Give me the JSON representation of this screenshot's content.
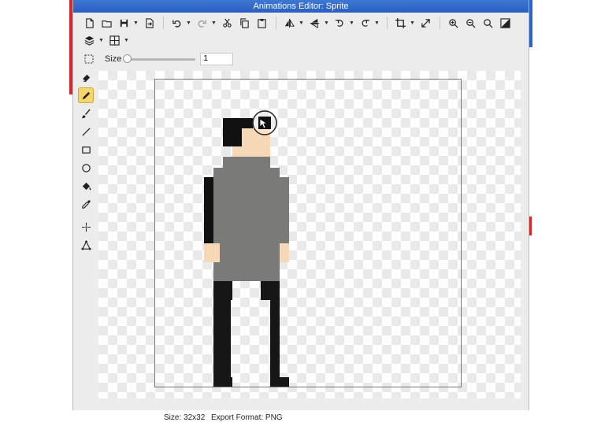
{
  "window": {
    "title": "Animations Editor: Sprite"
  },
  "toolbar": {
    "row1": [
      {
        "name": "new-file-icon",
        "caret": false
      },
      {
        "name": "open-folder-icon",
        "caret": false
      },
      {
        "name": "save-icon",
        "caret": true
      },
      {
        "name": "export-icon",
        "caret": false
      },
      {
        "sep": true
      },
      {
        "name": "undo-icon",
        "caret": true
      },
      {
        "name": "redo-icon",
        "caret": true
      },
      {
        "name": "cut-icon",
        "caret": false
      },
      {
        "name": "copy-icon",
        "caret": false
      },
      {
        "name": "paste-icon",
        "caret": false
      },
      {
        "sep": true
      },
      {
        "name": "flip-horizontal-icon",
        "caret": true
      },
      {
        "name": "flip-vertical-icon",
        "caret": true
      },
      {
        "name": "rotate-left-icon",
        "caret": true
      },
      {
        "name": "rotate-right-icon",
        "caret": true
      },
      {
        "sep": true
      },
      {
        "name": "crop-icon",
        "caret": true
      },
      {
        "name": "resize-icon",
        "caret": false
      },
      {
        "sep": true
      },
      {
        "name": "zoom-in-icon",
        "caret": false
      },
      {
        "name": "zoom-out-icon",
        "caret": false
      },
      {
        "name": "zoom-fit-icon",
        "caret": false
      },
      {
        "name": "invert-icon",
        "caret": false
      }
    ],
    "row2": [
      {
        "name": "layers-icon",
        "caret": true
      },
      {
        "name": "grid-icon",
        "caret": true
      }
    ]
  },
  "brush": {
    "size_label": "Size",
    "size_value": "1",
    "size_fraction": 0.0
  },
  "tools": [
    {
      "name": "eraser-icon",
      "active": false
    },
    {
      "name": "pencil-icon",
      "active": true
    },
    {
      "name": "brush-icon",
      "active": false
    },
    {
      "name": "line-icon",
      "active": false
    },
    {
      "name": "rectangle-icon",
      "active": false
    },
    {
      "name": "ellipse-icon",
      "active": false
    },
    {
      "name": "fill-bucket-icon",
      "active": false
    },
    {
      "name": "eyedropper-icon",
      "active": false
    },
    {
      "gap": true
    },
    {
      "name": "magic-wand-icon",
      "active": false
    },
    {
      "name": "transform-icon",
      "active": false
    }
  ],
  "status": {
    "size_text": "Size: 32x32",
    "format_text": "Export Format: PNG"
  },
  "colors": {
    "hair": "#111111",
    "skin": "#f7d8b6",
    "shirt": "#7a7a78",
    "pants": "#161616",
    "highlight": "#f5d66a"
  }
}
